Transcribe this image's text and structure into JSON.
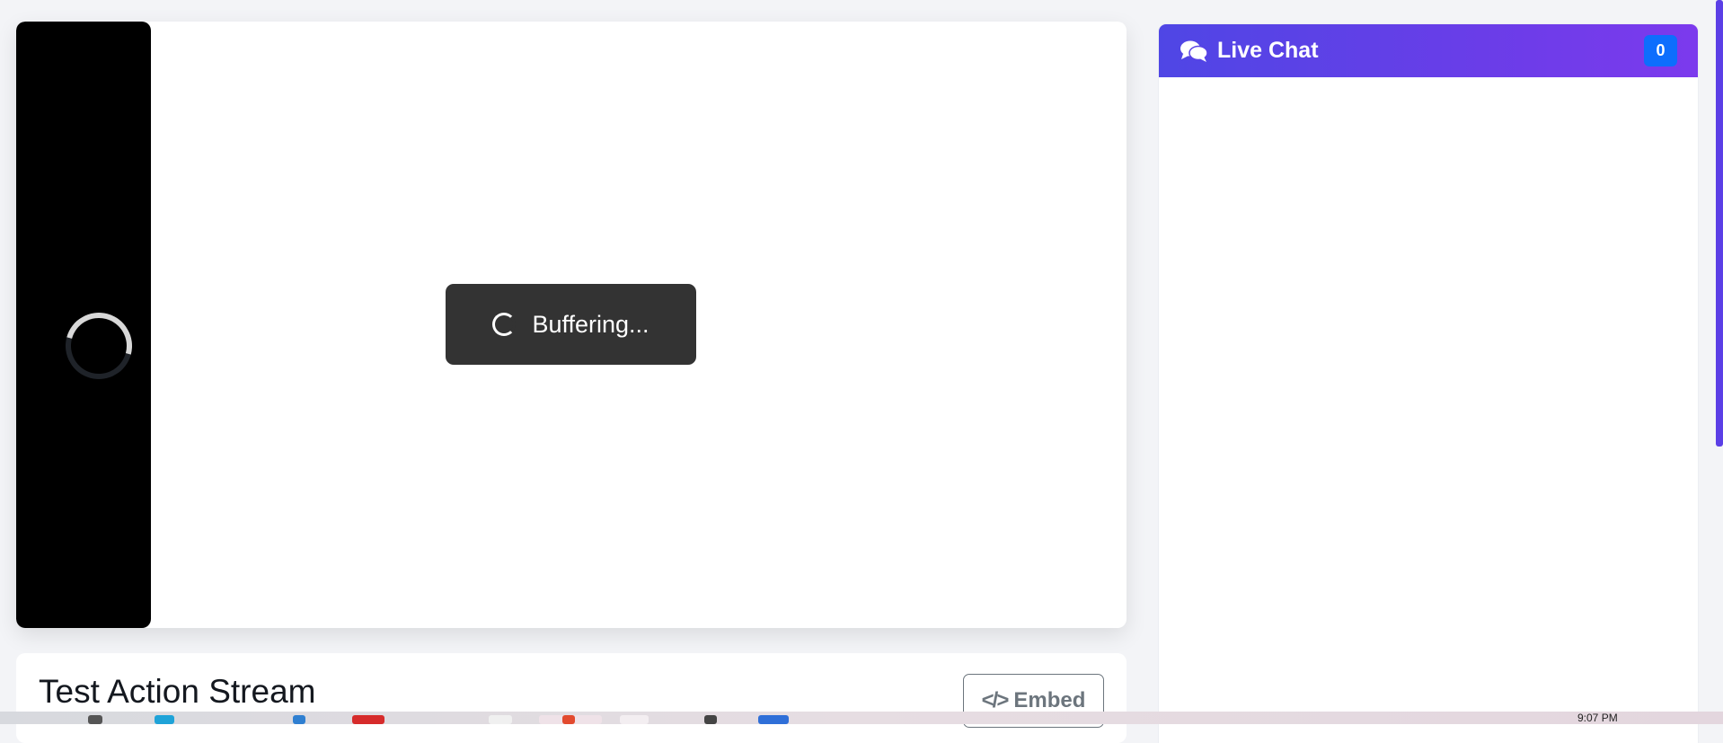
{
  "player": {
    "buffering_text": "Buffering..."
  },
  "stream": {
    "title": "Test Action Stream",
    "embed_label": "Embed"
  },
  "chat": {
    "title": "Live Chat",
    "count": "0"
  },
  "taskbar": {
    "clock": "9:07 PM"
  },
  "colors": {
    "chat_header_start": "#4f46e5",
    "chat_header_end": "#7c3aed",
    "badge": "#0d6efd",
    "buffer_box": "#333333"
  },
  "icons": [
    "loading-spinner-icon",
    "comments-icon",
    "code-icon"
  ]
}
